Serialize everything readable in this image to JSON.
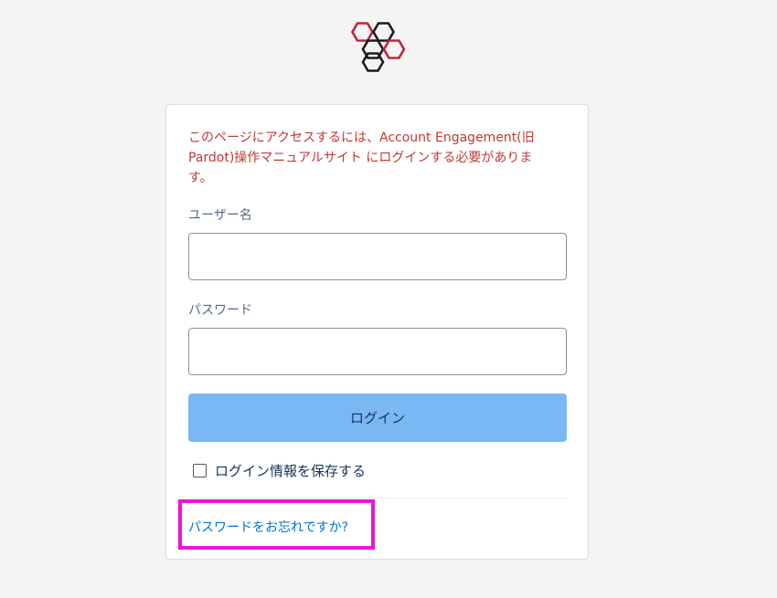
{
  "logo": {
    "icon": "hexagon-cluster-logo",
    "colors": {
      "red": "#c0263a",
      "black": "#1c1c1c"
    }
  },
  "login": {
    "error_message": "このページにアクセスするには、Account Engagement(旧Pardot)操作マニュアルサイト にログインする必要があります。",
    "username_label": "ユーザー名",
    "username_value": "",
    "password_label": "パスワード",
    "password_value": "",
    "login_button_label": "ログイン",
    "remember_label": "ログイン情報を保存する",
    "remember_checked": false,
    "forgot_password_label": "パスワードをお忘れですか?"
  },
  "colors": {
    "background": "#f4f4f4",
    "error_text": "#c23934",
    "button": "#7ab7f5",
    "link": "#0070d2",
    "highlight": "#ee14d8"
  }
}
